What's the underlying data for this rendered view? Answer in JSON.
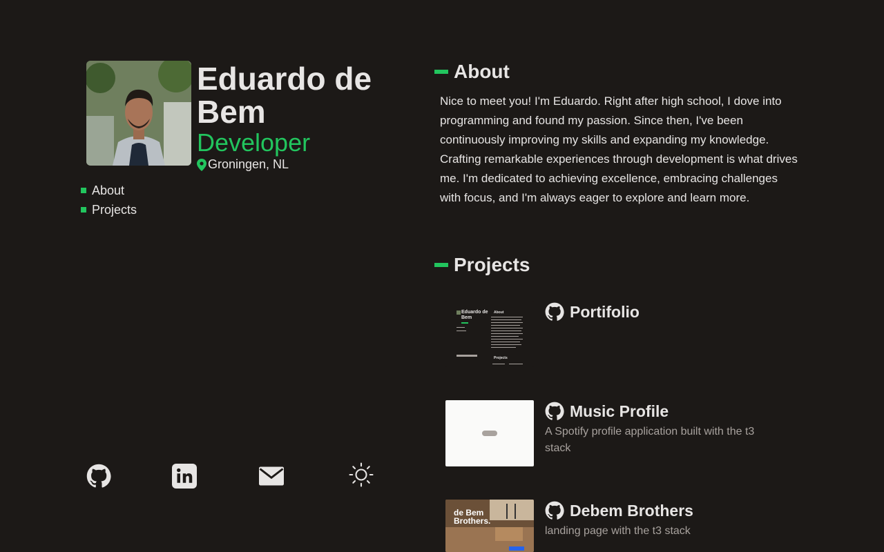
{
  "profile": {
    "name": "Eduardo de Bem",
    "role": "Developer",
    "location": "Groningen, NL"
  },
  "nav": {
    "items": [
      {
        "label": "About"
      },
      {
        "label": "Projects"
      }
    ]
  },
  "socials": {
    "icons": [
      "github-icon",
      "linkedin-icon",
      "mail-icon",
      "sun-icon"
    ]
  },
  "about": {
    "title": "About",
    "text": "Nice to meet you! I'm Eduardo. Right after high school, I dove into programming and found my passion. Since then, I've been continuously improving my skills and expanding my knowledge. Crafting remarkable experiences through development is what drives me. I'm dedicated to achieving excellence, embracing challenges with focus, and I'm always eager to explore and learn more."
  },
  "projects": {
    "title": "Projects",
    "items": [
      {
        "title": "Portifolio",
        "description": ""
      },
      {
        "title": "Music Profile",
        "description": "A Spotify profile application built with the t3 stack"
      },
      {
        "title": "Debem Brothers",
        "description": "landing page with the t3 stack",
        "thumb_text": "de Bem Brothers."
      }
    ]
  },
  "colors": {
    "background": "#1c1917",
    "accent": "#22c55e",
    "text": "#e7e5e4",
    "muted": "#a8a29e"
  }
}
